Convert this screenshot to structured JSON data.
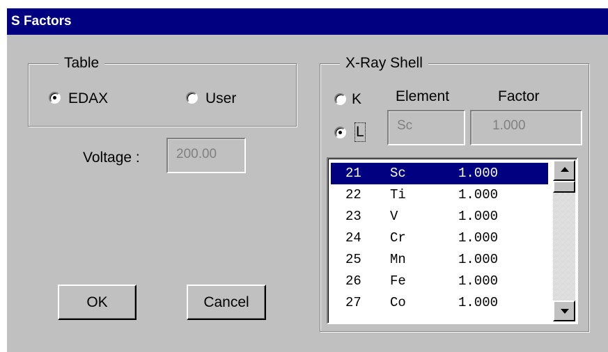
{
  "window": {
    "title": "S Factors"
  },
  "table_group": {
    "label": "Table",
    "options": [
      {
        "label": "EDAX",
        "selected": true
      },
      {
        "label": "User",
        "selected": false
      }
    ]
  },
  "voltage": {
    "label": "Voltage :",
    "value": "200.00"
  },
  "xray_group": {
    "label": "X-Ray Shell",
    "shells": [
      {
        "label": "K",
        "selected": false
      },
      {
        "label": "L",
        "selected": true
      }
    ],
    "element_header": "Element",
    "factor_header": "Factor",
    "element_value": "Sc",
    "factor_value": "1.000"
  },
  "list": {
    "rows": [
      {
        "z": "21",
        "symbol": "Sc",
        "factor": "1.000",
        "selected": true
      },
      {
        "z": "22",
        "symbol": "Ti",
        "factor": "1.000",
        "selected": false
      },
      {
        "z": "23",
        "symbol": "V",
        "factor": "1.000",
        "selected": false
      },
      {
        "z": "24",
        "symbol": "Cr",
        "factor": "1.000",
        "selected": false
      },
      {
        "z": "25",
        "symbol": "Mn",
        "factor": "1.000",
        "selected": false
      },
      {
        "z": "26",
        "symbol": "Fe",
        "factor": "1.000",
        "selected": false
      },
      {
        "z": "27",
        "symbol": "Co",
        "factor": "1.000",
        "selected": false
      }
    ]
  },
  "buttons": {
    "ok": "OK",
    "cancel": "Cancel"
  },
  "colors": {
    "title_bar": "#000080",
    "face": "#c0c0c0",
    "selection": "#000080"
  }
}
